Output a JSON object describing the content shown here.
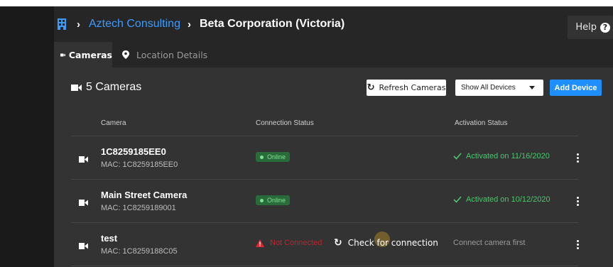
{
  "breadcrumb": {
    "org": "Aztech Consulting",
    "site": "Beta Corporation (Victoria)"
  },
  "help_label": "Help",
  "tabs": [
    {
      "label": "Cameras",
      "active": true,
      "icon": "video-camera-icon"
    },
    {
      "label": "Location Details",
      "active": false,
      "icon": "map-pin-icon"
    }
  ],
  "panel": {
    "title": "5 Cameras",
    "refresh_label": "Refresh Cameras",
    "filter_value": "Show All Devices",
    "add_label": "Add Device"
  },
  "table": {
    "columns": [
      "Camera",
      "Connection Status",
      "Activation Status"
    ],
    "rows": [
      {
        "name": "1C8259185EE0",
        "mac": "MAC: 1C8259185EE0",
        "status": "Online",
        "activation": "Activated on 11/16/2020"
      },
      {
        "name": "Main Street Camera",
        "mac": "MAC: 1C8259189001",
        "status": "Online",
        "activation": "Activated on 10/12/2020"
      },
      {
        "name": "test",
        "mac": "MAC: 1C8259188C05",
        "status": "Not Connected",
        "check_label": "Check for connection",
        "activation": "Connect camera first"
      }
    ]
  },
  "colors": {
    "accent_blue": "#1f8fff",
    "link_blue": "#3b9bff",
    "online_green": "#7fe08f",
    "activated_green": "#47c96a",
    "error_red": "#c0232a"
  }
}
